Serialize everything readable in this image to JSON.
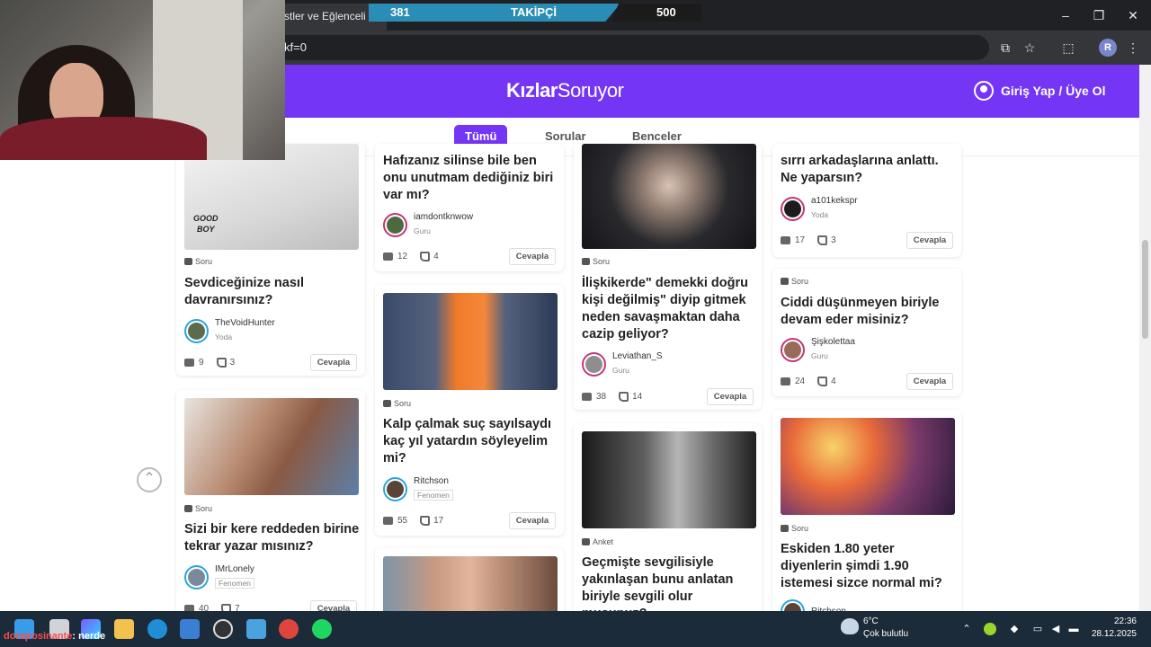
{
  "browser": {
    "tab_title": "stler ve Eğlenceli",
    "url_fragment": "kf=0",
    "profile_initial": "R",
    "minimize": "–",
    "restore": "❐",
    "close": "✕"
  },
  "overlay": {
    "follower_current": "381",
    "follower_label": "TAKİPÇİ",
    "follower_goal": "500"
  },
  "site": {
    "logo_main": "Kızlar",
    "logo_accent": "Soruyor",
    "login_label": "Giriş Yap / Üye Ol",
    "tabs": [
      "Tümü",
      "Sorular",
      "Benceler"
    ],
    "active_tab": "Tümü",
    "scroll_top_icon": "chevron-up-icon",
    "reply_label": "Cevapla"
  },
  "cards": {
    "c1": {
      "type": "Soru",
      "title": "Sevdiceğinize nasıl davranırsınız?",
      "author": "TheVoidHunter",
      "rank": "Yoda",
      "answers": "9",
      "likes": "3",
      "image_text_1": "GOOD",
      "image_text_2": "BOY"
    },
    "c2": {
      "type": "Soru",
      "title": "Sizi bir kere reddeden birine tekrar yazar mısınız?",
      "author": "IMrLonely",
      "rank": "Fenomen",
      "answers": "40",
      "likes": "7"
    },
    "c3": {
      "title": "Hafızanız silinse bile ben onu unutmam dediğiniz biri var mı?",
      "author": "iamdontknwow",
      "rank": "Guru",
      "answers": "12",
      "likes": "4"
    },
    "c4": {
      "type": "Soru",
      "title": "Kalp çalmak suç sayılsaydı kaç yıl yatardın söyleyelim mi?",
      "author": "Ritchson",
      "rank": "Fenomen",
      "answers": "55",
      "likes": "17"
    },
    "c5": {
      "type": "Soru",
      "title": "İlişkikerde\" demekki doğru kişi değilmiş\" diyip gitmek neden savaşmaktan daha cazip geliyor?",
      "author": "Leviathan_S",
      "rank": "Guru",
      "answers": "38",
      "likes": "14"
    },
    "c6": {
      "type": "Anket",
      "title": "Geçmişte sevgilisiyle yakınlaşan bunu anlatan biriyle sevgili olur musunuz?"
    },
    "c7": {
      "title": "sırrı arkadaşlarına anlattı. Ne yaparsın?",
      "author": "a101kekspr",
      "rank": "Yoda",
      "answers": "17",
      "likes": "3"
    },
    "c8": {
      "type": "Soru",
      "title": "Ciddi düşünmeyen biriyle devam eder misiniz?",
      "author": "Şişkolettaa",
      "rank": "Guru",
      "answers": "24",
      "likes": "4"
    },
    "c9": {
      "type": "Soru",
      "title": "Eskiden 1.80 yeter diyenlerin şimdi 1.90 istemesi sizce normal mi?",
      "author": "Ritchson"
    }
  },
  "taskbar": {
    "chat_user": "donqrosinante",
    "chat_message": ": nerde",
    "weather_temp": "6°C",
    "weather_desc": "Çok bulutlu",
    "time": "22:36",
    "date": "28.12.2025",
    "tray_up": "⌃"
  },
  "colors": {
    "brand": "#7435f5",
    "overlay_bar": "#2a8db5",
    "taskbar": "#1c2b3a"
  }
}
